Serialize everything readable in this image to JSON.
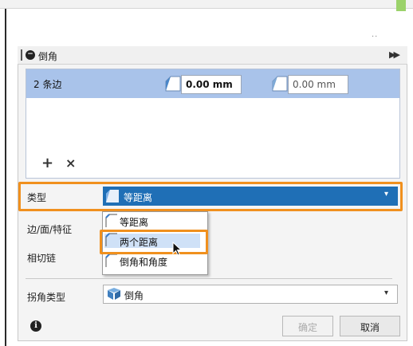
{
  "dialog": {
    "title": "倒角",
    "edges": {
      "count_label": "2 条边",
      "distance1": "0.00 mm",
      "distance2": "0.00 mm",
      "add": "+",
      "remove": "×"
    },
    "type": {
      "label": "类型",
      "value": "等距离",
      "options": [
        "等距离",
        "两个距离",
        "倒角和角度"
      ],
      "hovered_option": "两个距离"
    },
    "edge_face_feature_label": "边/面/特征",
    "tangent_chain_label": "相切链",
    "corner_type": {
      "label": "拐角类型",
      "value": "倒角"
    },
    "buttons": {
      "ok": "确定",
      "cancel": "取消"
    }
  },
  "colors": {
    "accent": "#1f6fb6",
    "highlight": "#f0901e",
    "row_selected": "#a9c3ea"
  },
  "icons": [
    "minus-circle-icon",
    "fast-forward-icon",
    "chamfer-icon",
    "plus-icon",
    "close-icon",
    "dropdown-caret-icon",
    "corner-icon",
    "info-icon",
    "mouse-cursor-icon"
  ]
}
